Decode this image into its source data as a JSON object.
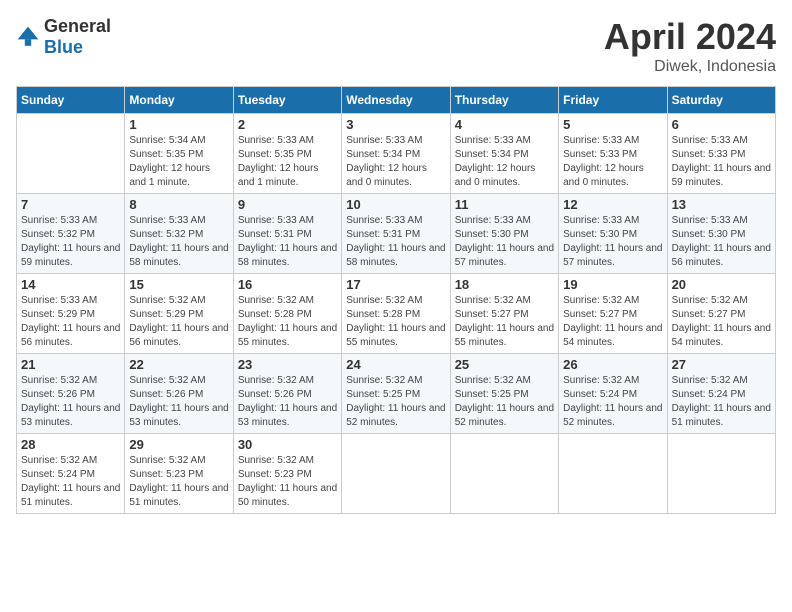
{
  "header": {
    "logo_general": "General",
    "logo_blue": "Blue",
    "month": "April 2024",
    "location": "Diwek, Indonesia"
  },
  "days_of_week": [
    "Sunday",
    "Monday",
    "Tuesday",
    "Wednesday",
    "Thursday",
    "Friday",
    "Saturday"
  ],
  "weeks": [
    [
      {
        "day": "",
        "empty": true
      },
      {
        "day": "1",
        "sunrise": "Sunrise: 5:34 AM",
        "sunset": "Sunset: 5:35 PM",
        "daylight": "Daylight: 12 hours and 1 minute."
      },
      {
        "day": "2",
        "sunrise": "Sunrise: 5:33 AM",
        "sunset": "Sunset: 5:35 PM",
        "daylight": "Daylight: 12 hours and 1 minute."
      },
      {
        "day": "3",
        "sunrise": "Sunrise: 5:33 AM",
        "sunset": "Sunset: 5:34 PM",
        "daylight": "Daylight: 12 hours and 0 minutes."
      },
      {
        "day": "4",
        "sunrise": "Sunrise: 5:33 AM",
        "sunset": "Sunset: 5:34 PM",
        "daylight": "Daylight: 12 hours and 0 minutes."
      },
      {
        "day": "5",
        "sunrise": "Sunrise: 5:33 AM",
        "sunset": "Sunset: 5:33 PM",
        "daylight": "Daylight: 12 hours and 0 minutes."
      },
      {
        "day": "6",
        "sunrise": "Sunrise: 5:33 AM",
        "sunset": "Sunset: 5:33 PM",
        "daylight": "Daylight: 11 hours and 59 minutes."
      }
    ],
    [
      {
        "day": "7",
        "sunrise": "Sunrise: 5:33 AM",
        "sunset": "Sunset: 5:32 PM",
        "daylight": "Daylight: 11 hours and 59 minutes."
      },
      {
        "day": "8",
        "sunrise": "Sunrise: 5:33 AM",
        "sunset": "Sunset: 5:32 PM",
        "daylight": "Daylight: 11 hours and 58 minutes."
      },
      {
        "day": "9",
        "sunrise": "Sunrise: 5:33 AM",
        "sunset": "Sunset: 5:31 PM",
        "daylight": "Daylight: 11 hours and 58 minutes."
      },
      {
        "day": "10",
        "sunrise": "Sunrise: 5:33 AM",
        "sunset": "Sunset: 5:31 PM",
        "daylight": "Daylight: 11 hours and 58 minutes."
      },
      {
        "day": "11",
        "sunrise": "Sunrise: 5:33 AM",
        "sunset": "Sunset: 5:30 PM",
        "daylight": "Daylight: 11 hours and 57 minutes."
      },
      {
        "day": "12",
        "sunrise": "Sunrise: 5:33 AM",
        "sunset": "Sunset: 5:30 PM",
        "daylight": "Daylight: 11 hours and 57 minutes."
      },
      {
        "day": "13",
        "sunrise": "Sunrise: 5:33 AM",
        "sunset": "Sunset: 5:30 PM",
        "daylight": "Daylight: 11 hours and 56 minutes."
      }
    ],
    [
      {
        "day": "14",
        "sunrise": "Sunrise: 5:33 AM",
        "sunset": "Sunset: 5:29 PM",
        "daylight": "Daylight: 11 hours and 56 minutes."
      },
      {
        "day": "15",
        "sunrise": "Sunrise: 5:32 AM",
        "sunset": "Sunset: 5:29 PM",
        "daylight": "Daylight: 11 hours and 56 minutes."
      },
      {
        "day": "16",
        "sunrise": "Sunrise: 5:32 AM",
        "sunset": "Sunset: 5:28 PM",
        "daylight": "Daylight: 11 hours and 55 minutes."
      },
      {
        "day": "17",
        "sunrise": "Sunrise: 5:32 AM",
        "sunset": "Sunset: 5:28 PM",
        "daylight": "Daylight: 11 hours and 55 minutes."
      },
      {
        "day": "18",
        "sunrise": "Sunrise: 5:32 AM",
        "sunset": "Sunset: 5:27 PM",
        "daylight": "Daylight: 11 hours and 55 minutes."
      },
      {
        "day": "19",
        "sunrise": "Sunrise: 5:32 AM",
        "sunset": "Sunset: 5:27 PM",
        "daylight": "Daylight: 11 hours and 54 minutes."
      },
      {
        "day": "20",
        "sunrise": "Sunrise: 5:32 AM",
        "sunset": "Sunset: 5:27 PM",
        "daylight": "Daylight: 11 hours and 54 minutes."
      }
    ],
    [
      {
        "day": "21",
        "sunrise": "Sunrise: 5:32 AM",
        "sunset": "Sunset: 5:26 PM",
        "daylight": "Daylight: 11 hours and 53 minutes."
      },
      {
        "day": "22",
        "sunrise": "Sunrise: 5:32 AM",
        "sunset": "Sunset: 5:26 PM",
        "daylight": "Daylight: 11 hours and 53 minutes."
      },
      {
        "day": "23",
        "sunrise": "Sunrise: 5:32 AM",
        "sunset": "Sunset: 5:26 PM",
        "daylight": "Daylight: 11 hours and 53 minutes."
      },
      {
        "day": "24",
        "sunrise": "Sunrise: 5:32 AM",
        "sunset": "Sunset: 5:25 PM",
        "daylight": "Daylight: 11 hours and 52 minutes."
      },
      {
        "day": "25",
        "sunrise": "Sunrise: 5:32 AM",
        "sunset": "Sunset: 5:25 PM",
        "daylight": "Daylight: 11 hours and 52 minutes."
      },
      {
        "day": "26",
        "sunrise": "Sunrise: 5:32 AM",
        "sunset": "Sunset: 5:24 PM",
        "daylight": "Daylight: 11 hours and 52 minutes."
      },
      {
        "day": "27",
        "sunrise": "Sunrise: 5:32 AM",
        "sunset": "Sunset: 5:24 PM",
        "daylight": "Daylight: 11 hours and 51 minutes."
      }
    ],
    [
      {
        "day": "28",
        "sunrise": "Sunrise: 5:32 AM",
        "sunset": "Sunset: 5:24 PM",
        "daylight": "Daylight: 11 hours and 51 minutes."
      },
      {
        "day": "29",
        "sunrise": "Sunrise: 5:32 AM",
        "sunset": "Sunset: 5:23 PM",
        "daylight": "Daylight: 11 hours and 51 minutes."
      },
      {
        "day": "30",
        "sunrise": "Sunrise: 5:32 AM",
        "sunset": "Sunset: 5:23 PM",
        "daylight": "Daylight: 11 hours and 50 minutes."
      },
      {
        "day": "",
        "empty": true
      },
      {
        "day": "",
        "empty": true
      },
      {
        "day": "",
        "empty": true
      },
      {
        "day": "",
        "empty": true
      }
    ]
  ]
}
